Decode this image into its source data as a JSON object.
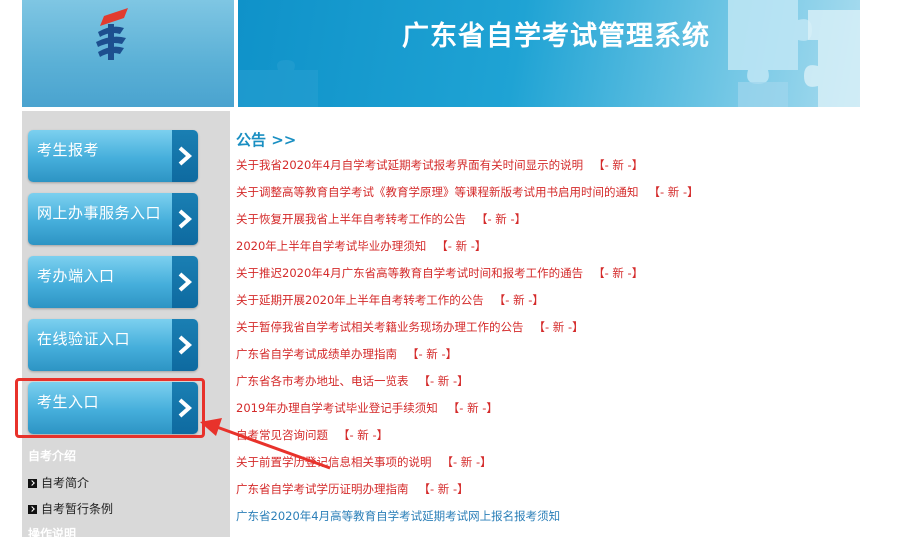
{
  "header": {
    "title": "广东省自学考试管理系统"
  },
  "nav": [
    {
      "label": "考生报考"
    },
    {
      "label": "网上办事服务入口"
    },
    {
      "label": "考办端入口"
    },
    {
      "label": "在线验证入口"
    },
    {
      "label": "考生入口"
    }
  ],
  "sidebar": {
    "section1": "自考介绍",
    "links": [
      "自考简介",
      "自考暂行条例"
    ],
    "section2": "操作说明"
  },
  "notices": {
    "heading": "公告 >>",
    "new_tag": "【- 新 -】",
    "items": [
      "关于我省2020年4月自学考试延期考试报考界面有关时间显示的说明",
      "关于调整高等教育自学考试《教育学原理》等课程新版考试用书启用时间的通知",
      "关于恢复开展我省上半年自考转考工作的公告",
      "2020年上半年自学考试毕业办理须知",
      "关于推迟2020年4月广东省高等教育自学考试时间和报考工作的通告",
      "关于延期开展2020年上半年自考转考工作的公告",
      "关于暂停我省自学考试相关考籍业务现场办理工作的公告",
      "广东省自学考试成绩单办理指南",
      "广东省各市考办地址、电话一览表",
      "2019年办理自学考试毕业登记手续须知",
      "自考常见咨询问题",
      "关于前置学历登记信息相关事项的说明",
      "广东省自学考试学历证明办理指南",
      "广东省2020年4月高等教育自学考试延期考试网上报名报考须知"
    ]
  },
  "colors": {
    "accent": "#1a8fc2",
    "notice_red": "#d42a2a",
    "highlight": "#e8322b"
  }
}
